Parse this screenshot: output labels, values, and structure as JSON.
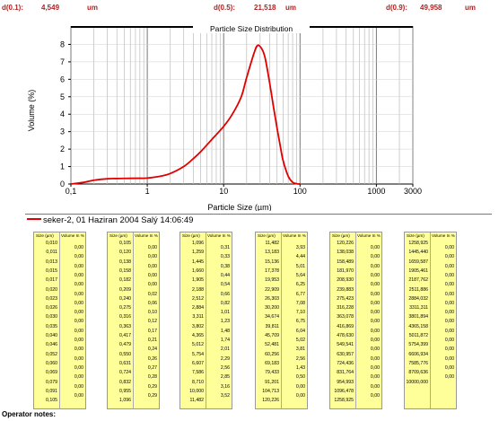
{
  "stats": [
    {
      "label": "d(0.1):",
      "value": "4,549",
      "unit": "um"
    },
    {
      "label": "d(0.5):",
      "value": "21,518",
      "unit": "um"
    },
    {
      "label": "d(0.9):",
      "value": "49,958",
      "unit": "um"
    }
  ],
  "chart_data": {
    "type": "line",
    "title": "Particle Size Distribution",
    "xlabel": "Particle Size (µm)",
    "ylabel": "Volume (%)",
    "x_scale": "log",
    "xlim": [
      0.1,
      3000
    ],
    "ylim": [
      0,
      9
    ],
    "x_ticks": [
      "0,1",
      "1",
      "10",
      "100",
      "1000",
      "3000"
    ],
    "y_ticks": [
      "0",
      "1",
      "2",
      "3",
      "4",
      "5",
      "6",
      "7",
      "8"
    ],
    "grid": true,
    "series": [
      {
        "name": "seker-2, 01 Haziran 2004 Salý 14:06:49",
        "color": "#e00000",
        "x": [
          0.1,
          0.15,
          0.2,
          0.3,
          0.5,
          0.8,
          1,
          1.5,
          2,
          3,
          4,
          5,
          7,
          10,
          13,
          17,
          20,
          25,
          28,
          32,
          35,
          40,
          45,
          50,
          55,
          60,
          70,
          80,
          90,
          100
        ],
        "y": [
          0,
          0.1,
          0.22,
          0.3,
          0.32,
          0.33,
          0.34,
          0.45,
          0.6,
          1.0,
          1.45,
          1.85,
          2.55,
          3.3,
          4.0,
          5.0,
          6.1,
          7.5,
          7.95,
          7.7,
          7.2,
          5.8,
          4.4,
          3.2,
          2.2,
          1.35,
          0.45,
          0.1,
          0.02,
          0
        ]
      }
    ]
  },
  "legend_text": "seker-2, 01 Haziran 2004 Salý 14:06:49",
  "table_header": {
    "size": "Size (µm)",
    "vol": "Volume In %"
  },
  "tables": [
    {
      "sizes": [
        "0,010",
        "0,011",
        "0,013",
        "0,015",
        "0,017",
        "0,020",
        "0,023",
        "0,026",
        "0,030",
        "0,035",
        "0,040",
        "0,046",
        "0,052",
        "0,060",
        "0,069",
        "0,079",
        "0,091",
        "0,105"
      ],
      "vols": [
        "0,00",
        "0,00",
        "0,00",
        "0,00",
        "0,00",
        "0,00",
        "0,00",
        "0,00",
        "0,00",
        "0,00",
        "0,00",
        "0,00",
        "0,00",
        "0,00",
        "0,00",
        "0,00",
        "0,00"
      ]
    },
    {
      "sizes": [
        "0,105",
        "0,120",
        "0,138",
        "0,158",
        "0,182",
        "0,209",
        "0,240",
        "0,275",
        "0,316",
        "0,363",
        "0,417",
        "0,479",
        "0,550",
        "0,631",
        "0,724",
        "0,832",
        "0,955",
        "1,096"
      ],
      "vols": [
        "0,00",
        "0,00",
        "0,00",
        "0,00",
        "0,00",
        "0,02",
        "0,06",
        "0,10",
        "0,12",
        "0,17",
        "0,21",
        "0,24",
        "0,26",
        "0,27",
        "0,28",
        "0,29",
        "0,29"
      ]
    },
    {
      "sizes": [
        "1,096",
        "1,259",
        "1,445",
        "1,660",
        "1,905",
        "2,188",
        "2,512",
        "2,884",
        "3,311",
        "3,802",
        "4,365",
        "5,012",
        "5,754",
        "6,607",
        "7,586",
        "8,710",
        "10,000",
        "11,482"
      ],
      "vols": [
        "0,31",
        "0,33",
        "0,38",
        "0,44",
        "0,54",
        "0,66",
        "0,82",
        "1,01",
        "1,23",
        "1,48",
        "1,74",
        "2,01",
        "2,29",
        "2,56",
        "2,85",
        "3,16",
        "3,52"
      ]
    },
    {
      "sizes": [
        "11,482",
        "13,183",
        "15,136",
        "17,378",
        "19,953",
        "22,909",
        "26,303",
        "30,200",
        "34,674",
        "39,811",
        "45,709",
        "52,481",
        "60,256",
        "69,183",
        "79,433",
        "91,201",
        "104,713",
        "120,226"
      ],
      "vols": [
        "3,93",
        "4,44",
        "5,01",
        "5,64",
        "6,25",
        "6,77",
        "7,08",
        "7,10",
        "6,75",
        "6,04",
        "5,02",
        "3,81",
        "2,56",
        "1,43",
        "0,50",
        "0,00",
        "0,00"
      ]
    },
    {
      "sizes": [
        "120,226",
        "138,038",
        "158,489",
        "181,970",
        "208,930",
        "239,883",
        "275,423",
        "316,228",
        "363,078",
        "416,869",
        "478,630",
        "549,541",
        "630,957",
        "724,436",
        "831,764",
        "954,993",
        "1096,478",
        "1258,925"
      ],
      "vols": [
        "0,00",
        "0,00",
        "0,00",
        "0,00",
        "0,00",
        "0,00",
        "0,00",
        "0,00",
        "0,00",
        "0,00",
        "0,00",
        "0,00",
        "0,00",
        "0,00",
        "0,00",
        "0,00",
        "0,00"
      ]
    },
    {
      "sizes": [
        "1258,925",
        "1445,440",
        "1659,587",
        "1905,461",
        "2187,762",
        "2511,886",
        "2884,032",
        "3311,311",
        "3801,894",
        "4365,158",
        "5011,872",
        "5754,399",
        "6606,934",
        "7585,776",
        "8709,636",
        "10000,000"
      ],
      "vols": [
        "0,00",
        "0,00",
        "0,00",
        "0,00",
        "0,00",
        "0,00",
        "0,00",
        "0,00",
        "0,00",
        "0,00",
        "0,00",
        "0,00",
        "0,00",
        "0,00",
        "0,00"
      ]
    }
  ],
  "operator_label": "Operator notes:"
}
